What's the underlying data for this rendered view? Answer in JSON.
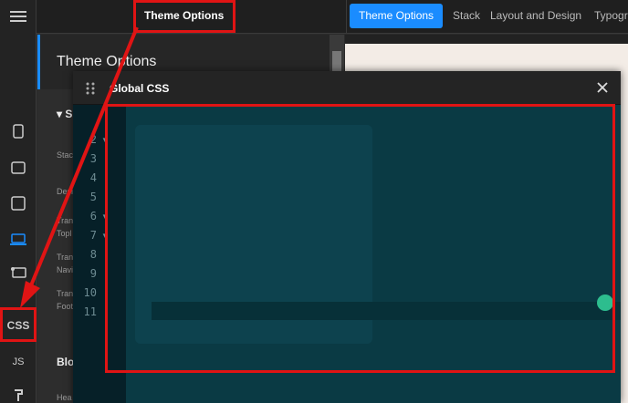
{
  "topbar": {
    "breadcrumb": "Theme Options",
    "tabs": [
      {
        "label": "Theme Options",
        "active": true
      },
      {
        "label": "Stack",
        "active": false
      },
      {
        "label": "Layout and Design",
        "active": false
      },
      {
        "label": "Typogr",
        "active": false
      }
    ]
  },
  "rail": {
    "css_label": "CSS",
    "js_label": "JS"
  },
  "panel": {
    "title": "Theme Options",
    "section": "S",
    "labels": [
      "Stac",
      "Desi",
      "Tran",
      "Topl",
      "Tran",
      "Navi",
      "Tran",
      "Foot"
    ],
    "bold_label": "Blo",
    "bottom_label": "Hea"
  },
  "modal": {
    "title": "Global CSS",
    "line_numbers": [
      "2",
      "3",
      "4",
      "5",
      "6",
      "7",
      "8",
      "9",
      "10",
      "11"
    ]
  },
  "colors": {
    "accent": "#1a8cff",
    "annotation": "#e01414",
    "editor_bg": "#0a3a44"
  }
}
